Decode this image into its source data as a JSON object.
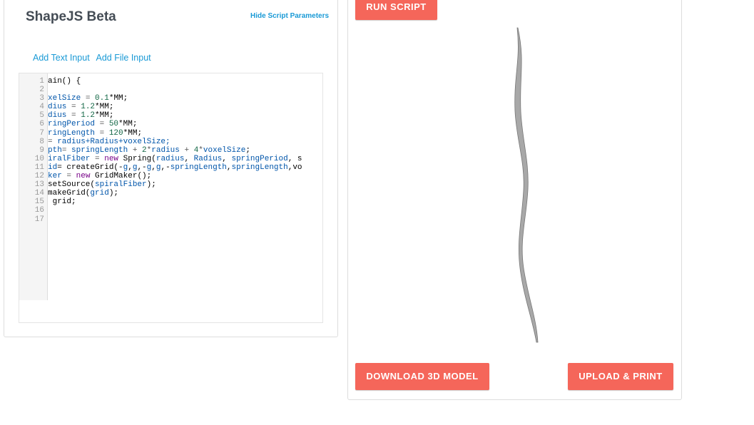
{
  "header": {
    "title": "ShapeJS Beta",
    "hide_params": "Hide Script Parameters"
  },
  "inputs": {
    "add_text": "Add Text Input",
    "add_file": "Add File Input"
  },
  "editor": {
    "lines": [
      [
        [
          "ain() {",
          "t"
        ]
      ],
      [],
      [
        [
          "xelSize",
          "v"
        ],
        [
          " = ",
          "o"
        ],
        [
          "0.1",
          "n"
        ],
        [
          "*MM;",
          "t"
        ]
      ],
      [
        [
          "dius",
          "v"
        ],
        [
          " = ",
          "o"
        ],
        [
          "1.2",
          "n"
        ],
        [
          "*MM;",
          "t"
        ]
      ],
      [
        [
          "dius",
          "v"
        ],
        [
          " = ",
          "o"
        ],
        [
          "1.2",
          "n"
        ],
        [
          "*MM;",
          "t"
        ]
      ],
      [
        [
          "ringPeriod",
          "v"
        ],
        [
          " = ",
          "o"
        ],
        [
          "50",
          "n"
        ],
        [
          "*MM;",
          "t"
        ]
      ],
      [
        [
          "ringLength",
          "v"
        ],
        [
          " = ",
          "o"
        ],
        [
          "120",
          "n"
        ],
        [
          "*MM;",
          "t"
        ]
      ],
      [
        [
          "= ",
          "o"
        ],
        [
          "radius+Radius+voxelSize;",
          "v"
        ]
      ],
      [
        [
          "pth",
          "v"
        ],
        [
          "= ",
          "o"
        ],
        [
          "springLength",
          "v"
        ],
        [
          " + ",
          "o"
        ],
        [
          "2",
          "n"
        ],
        [
          "*",
          "o"
        ],
        [
          "radius",
          "v"
        ],
        [
          " + ",
          "o"
        ],
        [
          "4",
          "n"
        ],
        [
          "*",
          "o"
        ],
        [
          "voxelSize",
          "v"
        ],
        [
          ";",
          "t"
        ]
      ],
      [
        [
          "iralFiber",
          "v"
        ],
        [
          " = ",
          "o"
        ],
        [
          "new",
          "k"
        ],
        [
          " Spring(",
          "t"
        ],
        [
          "radius",
          "v"
        ],
        [
          ", ",
          "t"
        ],
        [
          "Radius",
          "v"
        ],
        [
          ", ",
          "t"
        ],
        [
          "springPeriod",
          "v"
        ],
        [
          ", s",
          "t"
        ]
      ],
      [
        [
          "id",
          "v"
        ],
        [
          "= createGrid(-",
          "t"
        ],
        [
          "g",
          "v"
        ],
        [
          ",",
          "t"
        ],
        [
          "g",
          "v"
        ],
        [
          ",-",
          "t"
        ],
        [
          "g",
          "v"
        ],
        [
          ",",
          "t"
        ],
        [
          "g",
          "v"
        ],
        [
          ",-",
          "t"
        ],
        [
          "springLength",
          "v"
        ],
        [
          ",",
          "t"
        ],
        [
          "springLength",
          "v"
        ],
        [
          ",vo",
          "t"
        ]
      ],
      [
        [
          "ker",
          "v"
        ],
        [
          " = ",
          "o"
        ],
        [
          "new",
          "k"
        ],
        [
          " GridMaker();",
          "t"
        ]
      ],
      [
        [
          "setSource(",
          "t"
        ],
        [
          "spiralFiber",
          "v"
        ],
        [
          ");",
          "t"
        ]
      ],
      [
        [
          "makeGrid(",
          "t"
        ],
        [
          "grid",
          "v"
        ],
        [
          ");",
          "t"
        ]
      ],
      [
        [
          " grid;",
          "t"
        ]
      ],
      [],
      []
    ]
  },
  "buttons": {
    "run": "RUN SCRIPT",
    "download": "DOWNLOAD 3D MODEL",
    "upload": "UPLOAD & PRINT"
  },
  "colors": {
    "accent": "#f5665a",
    "link": "#1a9ad6"
  }
}
